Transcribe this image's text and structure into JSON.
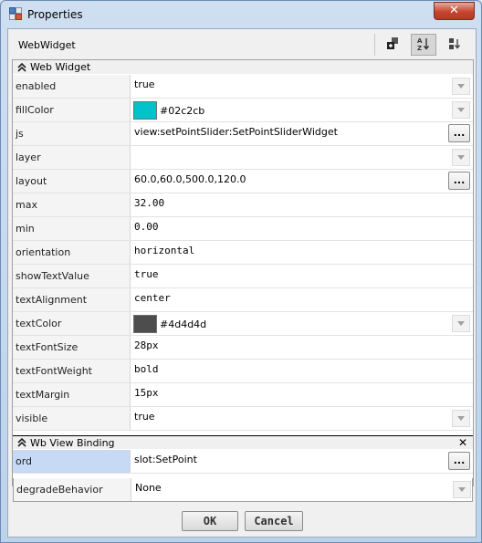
{
  "window": {
    "title": "Properties",
    "close_label": "✕"
  },
  "header": {
    "title": "WebWidget"
  },
  "sections": {
    "web_widget": {
      "title": "Web Widget"
    },
    "wb_view_binding": {
      "title": "Wb View Binding"
    }
  },
  "properties": {
    "enabled": {
      "name": "enabled",
      "value": "true"
    },
    "fillColor": {
      "name": "fillColor",
      "value": "#02c2cb",
      "color": "#02c2cb"
    },
    "js": {
      "name": "js",
      "value": "view:setPointSlider:SetPointSliderWidget"
    },
    "layer": {
      "name": "layer",
      "value": ""
    },
    "layout": {
      "name": "layout",
      "value": "60.0,60.0,500.0,120.0"
    },
    "max": {
      "name": "max",
      "value": "32.00"
    },
    "min": {
      "name": "min",
      "value": "0.00"
    },
    "orientation": {
      "name": "orientation",
      "value": "horizontal"
    },
    "showTextValue": {
      "name": "showTextValue",
      "value": "true"
    },
    "textAlignment": {
      "name": "textAlignment",
      "value": "center"
    },
    "textColor": {
      "name": "textColor",
      "value": "#4d4d4d",
      "color": "#4d4d4d"
    },
    "textFontSize": {
      "name": "textFontSize",
      "value": "28px"
    },
    "textFontWeight": {
      "name": "textFontWeight",
      "value": "bold"
    },
    "textMargin": {
      "name": "textMargin",
      "value": "15px"
    },
    "visible": {
      "name": "visible",
      "value": "true"
    },
    "ord": {
      "name": "ord",
      "value": "slot:SetPoint"
    },
    "degradeBehavior": {
      "name": "degradeBehavior",
      "value": "None"
    }
  },
  "buttons": {
    "ellipsis_label": "...",
    "ok_label": "OK",
    "cancel_label": "Cancel"
  },
  "icons": {
    "app": "properties-app-icon",
    "add": "add-slot-icon",
    "sort": "sort-az-icon",
    "move": "move-slot-icon",
    "collapse": "collapse-chevron-icon",
    "close_section": "close-section-icon"
  },
  "colors": {
    "selected_row": "#c6d9f5",
    "window_frame": "#bcd3ec",
    "close_button": "#c7452f"
  }
}
